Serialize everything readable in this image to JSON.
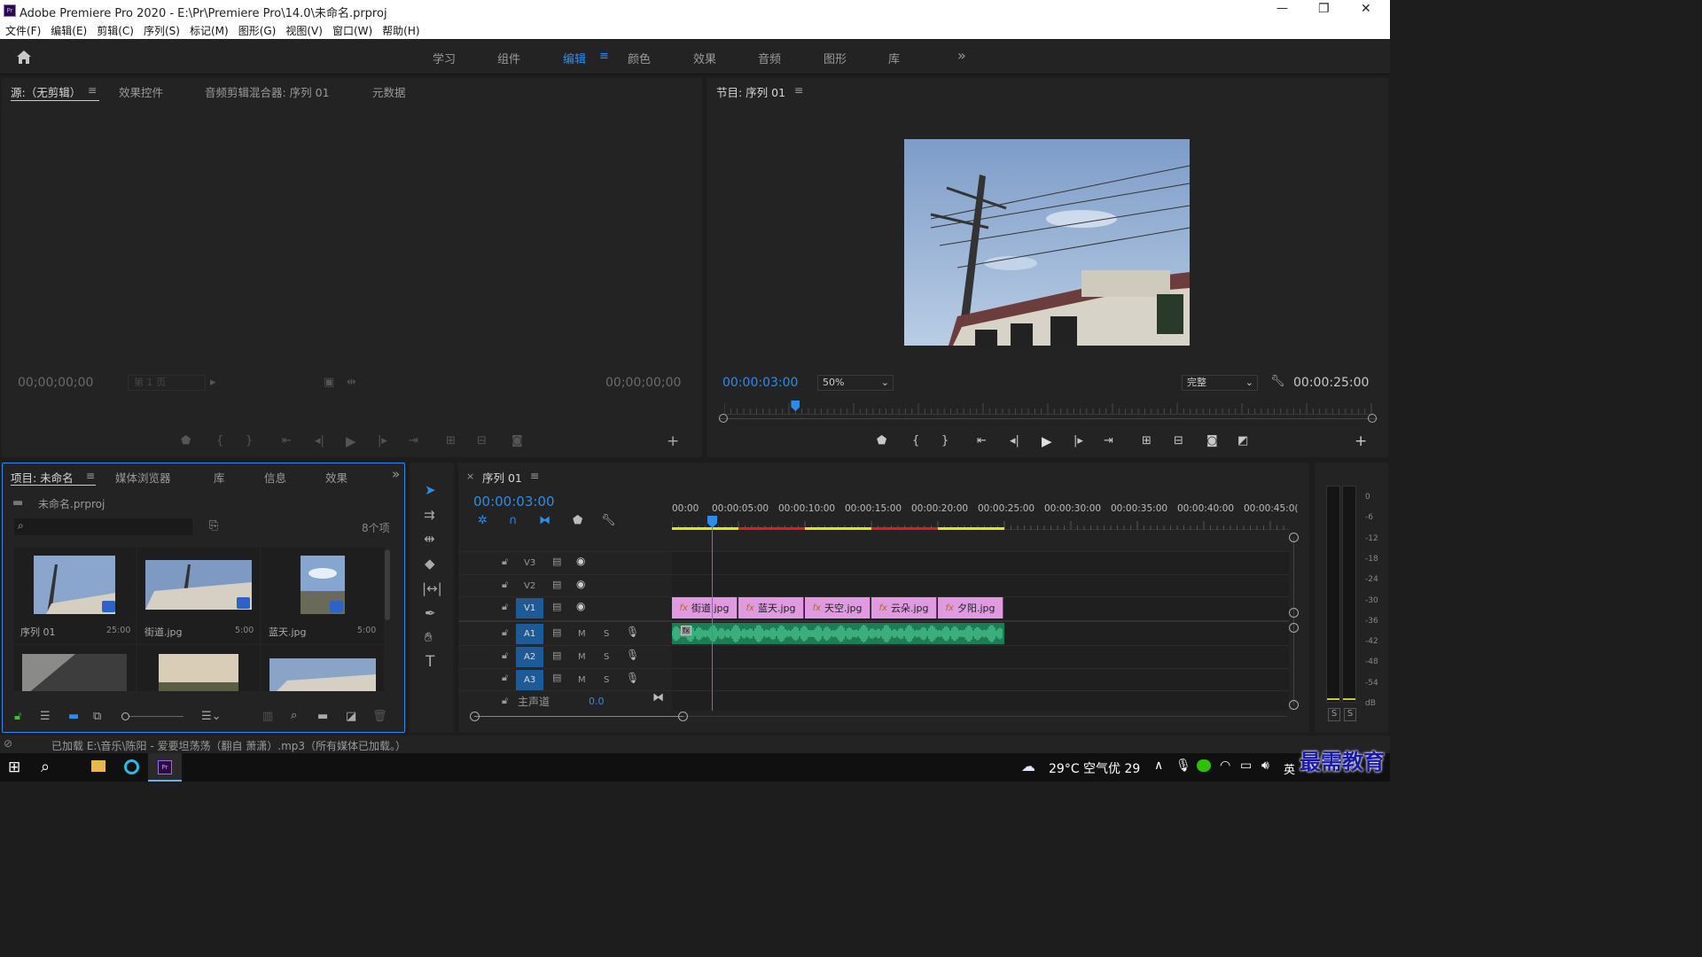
{
  "window": {
    "title": "Adobe Premiere Pro 2020 - E:\\Pr\\Premiere Pro\\14.0\\未命名.prproj",
    "minimize": "—",
    "restore": "❐",
    "close": "✕"
  },
  "menu": [
    "文件(F)",
    "编辑(E)",
    "剪辑(C)",
    "序列(S)",
    "标记(M)",
    "图形(G)",
    "视图(V)",
    "窗口(W)",
    "帮助(H)"
  ],
  "workspaces": {
    "items": [
      "学习",
      "组件",
      "编辑",
      "颜色",
      "效果",
      "音频",
      "图形",
      "库"
    ],
    "active": "编辑",
    "more": "»"
  },
  "source_panel": {
    "tabs": [
      "源:（无剪辑）",
      "效果控件",
      "音频剪辑混合器: 序列 01",
      "元数据"
    ],
    "timecode_in": "00;00;00;00",
    "timecode_out": "00;00;00;00",
    "page": "第 1 页"
  },
  "program_panel": {
    "tab": "节目: 序列 01",
    "timecode": "00:00:03:00",
    "zoom": "50%",
    "quality": "完整",
    "duration": "00:00:25:00",
    "playhead_fraction": 0.11
  },
  "project_panel": {
    "tabs": [
      "项目: 未命名",
      "媒体浏览器",
      "库",
      "信息",
      "效果"
    ],
    "file": "未命名.prproj",
    "search_placeholder": "",
    "count": "8个项",
    "items": [
      {
        "name": "序列 01",
        "duration": "25:00"
      },
      {
        "name": "街道.jpg",
        "duration": "5:00"
      },
      {
        "name": "蓝天.jpg",
        "duration": "5:00"
      }
    ]
  },
  "timeline": {
    "tab": "序列 01",
    "timecode": "00:00:03:00",
    "ruler": [
      "00:00",
      "00:00:05:00",
      "00:00:10:00",
      "00:00:15:00",
      "00:00:20:00",
      "00:00:25:00",
      "00:00:30:00",
      "00:00:35:00",
      "00:00:40:00",
      "00:00:45:0("
    ],
    "video_tracks": [
      "V3",
      "V2",
      "V1"
    ],
    "audio_tracks": [
      "A1",
      "A2",
      "A3"
    ],
    "mute": "M",
    "solo": "S",
    "master": {
      "label": "主声道",
      "value": "0.0"
    },
    "clips": [
      {
        "name": "街道.jpg",
        "start": 0,
        "end": 5
      },
      {
        "name": "蓝天.jpg",
        "start": 5,
        "end": 10
      },
      {
        "name": "天空.jpg",
        "start": 10,
        "end": 15
      },
      {
        "name": "云朵.jpg",
        "start": 15,
        "end": 20
      },
      {
        "name": "夕阳.jpg",
        "start": 20,
        "end": 25
      }
    ],
    "playhead_seconds": 3
  },
  "meter": {
    "scale": [
      "0",
      "-6",
      "-12",
      "-18",
      "-24",
      "-30",
      "-36",
      "-42",
      "-48",
      "-54",
      "dB"
    ],
    "solo_left": "S",
    "solo_right": "S"
  },
  "status": {
    "text": "已加载 E:\\音乐\\陈阳 - 爱要坦荡荡（翻自 萧潇）.mp3（所有媒体已加载。）"
  },
  "taskbar": {
    "weather": "29°C 空气优 29",
    "ime": "英",
    "watermark": "最需教育"
  },
  "colors": {
    "accent": "#2d8ceb",
    "clip": "#e09ae0",
    "audio": "#1fa06e",
    "panel": "#232323"
  }
}
